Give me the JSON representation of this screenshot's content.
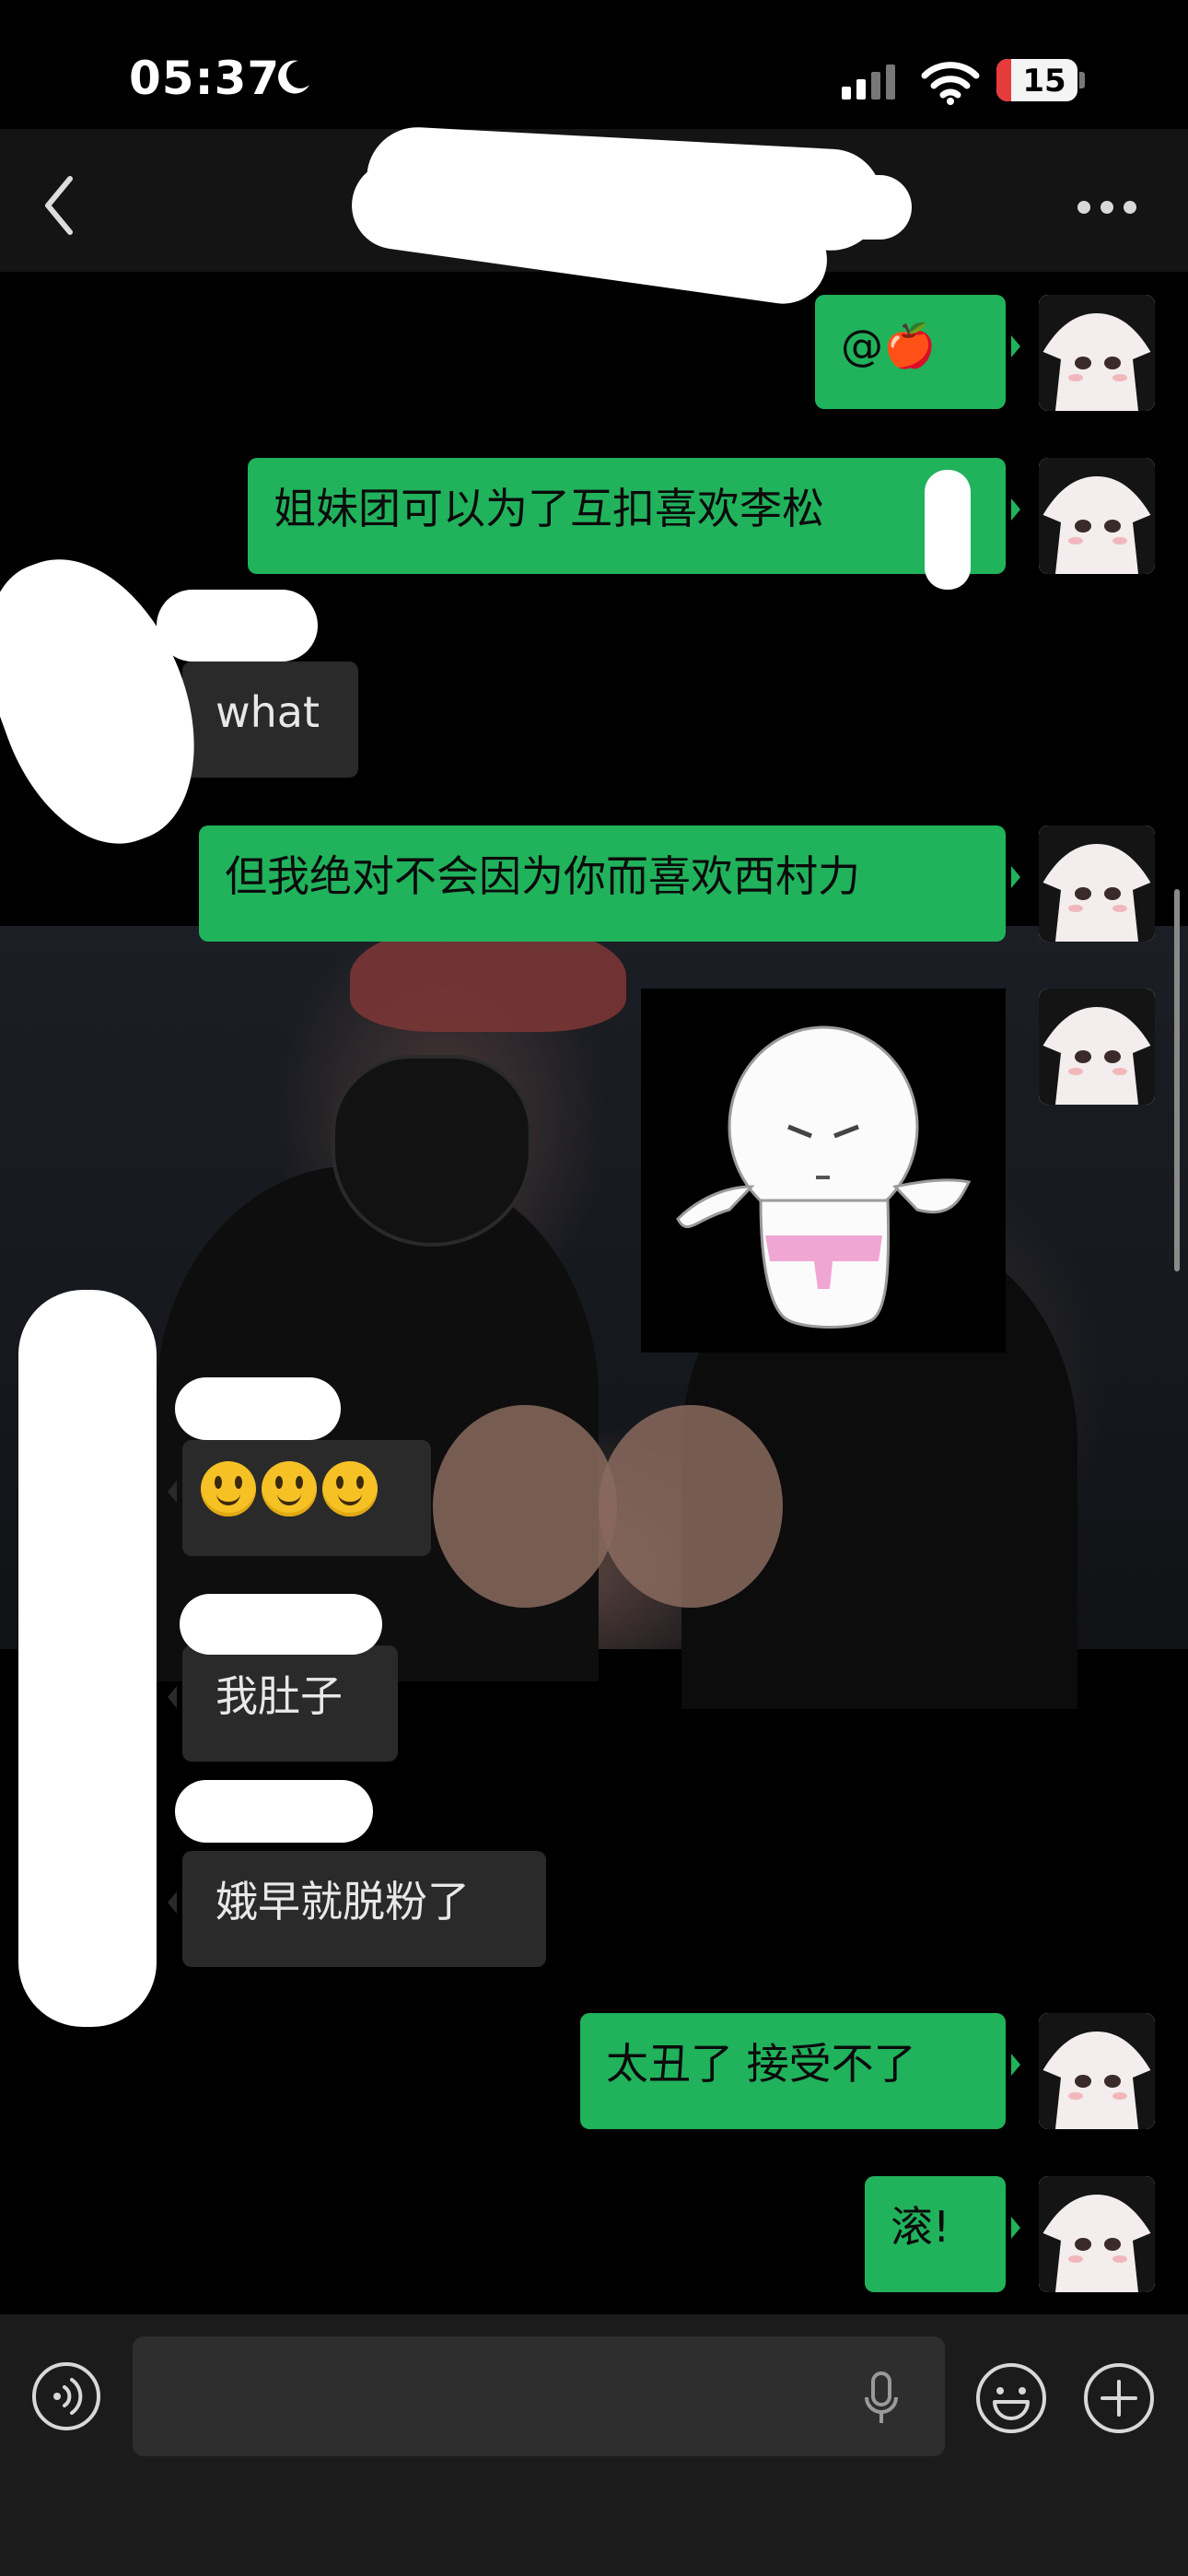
{
  "status_bar": {
    "time": "05:37",
    "battery": "15"
  },
  "header": {
    "title": ""
  },
  "messages": [
    {
      "side": "me",
      "text": "@🍎"
    },
    {
      "side": "me",
      "text": "姐妹团可以为了互扣喜欢李松"
    },
    {
      "side": "other",
      "text": "what"
    },
    {
      "side": "me",
      "text": "但我绝对不会因为你而喜欢西村力"
    },
    {
      "side": "me",
      "type": "sticker"
    },
    {
      "side": "other",
      "type": "emoji",
      "emoji": [
        "smiley",
        "smiley",
        "smiley"
      ]
    },
    {
      "side": "other",
      "text": "我肚子"
    },
    {
      "side": "other",
      "text": "娥早就脱粉了"
    },
    {
      "side": "me",
      "text": "太丑了 接受不了"
    },
    {
      "side": "me",
      "text": "滚!"
    }
  ],
  "input": {
    "placeholder": "",
    "value": ""
  },
  "icons": [
    "back-chevron-icon",
    "more-dots-icon",
    "voice-icon",
    "microphone-icon",
    "emoji-icon",
    "plus-icon",
    "moon-icon",
    "signal-icon",
    "wifi-icon",
    "battery-icon"
  ]
}
